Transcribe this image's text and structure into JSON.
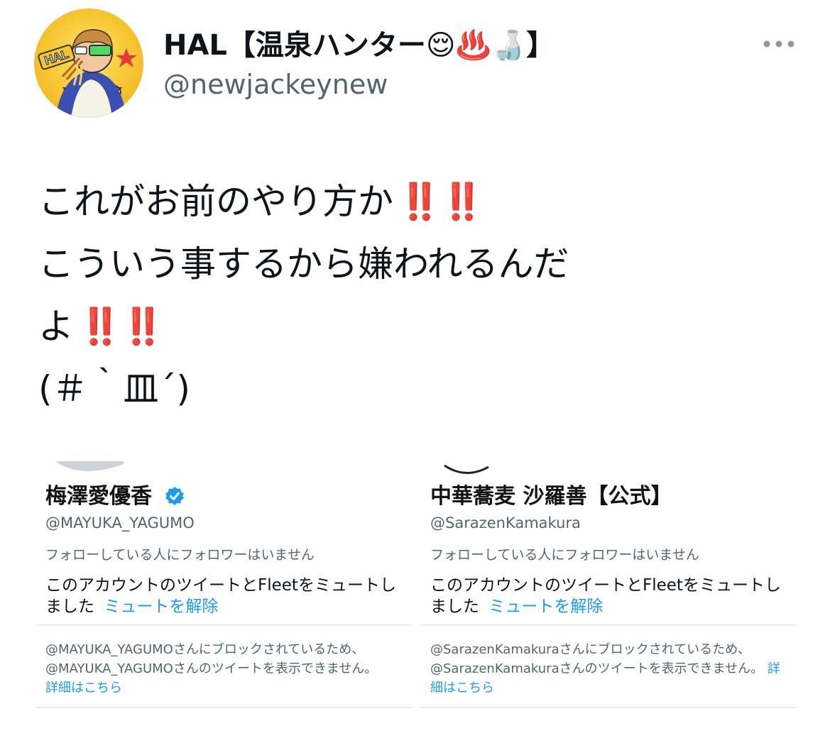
{
  "author": {
    "display_name": "HAL【温泉ハンター😌♨️🍶】",
    "handle": "@newjackeynew",
    "avatar_badge": "HAL"
  },
  "tweet": {
    "lines": [
      "これがお前のやり方か",
      "こういう事するから嫌われるんだ",
      "よ",
      "(＃｀皿´)"
    ],
    "exclamation": "‼️‼️"
  },
  "cards": [
    {
      "name": "梅澤愛優香",
      "handle": "@MAYUKA_YAGUMO",
      "follow_info": "フォローしている人にフォロワーはいません",
      "muted_text": "このアカウントのツイートとFleetをミュートしました",
      "unmute_link": "ミュートを解除",
      "blocked_text": "@MAYUKA_YAGUMOさんにブロックされているため、@MAYUKA_YAGUMOさんのツイートを表示できません。",
      "details_link": "詳細はこちら"
    },
    {
      "name": "中華蕎麦 沙羅善【公式】",
      "handle": "@SarazenKamakura",
      "follow_info": "フォローしている人にフォロワーはいません",
      "muted_text": "このアカウントのツイートとFleetをミュートしました",
      "unmute_link": "ミュートを解除",
      "blocked_text": "@SarazenKamakuraさんにブロックされているため、@SarazenKamakuraさんのツイートを表示できません。",
      "details_link": "詳細はこちら"
    }
  ],
  "colors": {
    "link": "#1d9bf0",
    "secondary_text": "#536471",
    "exclamation": "#e0282b",
    "verified": "#1d9bf0"
  }
}
